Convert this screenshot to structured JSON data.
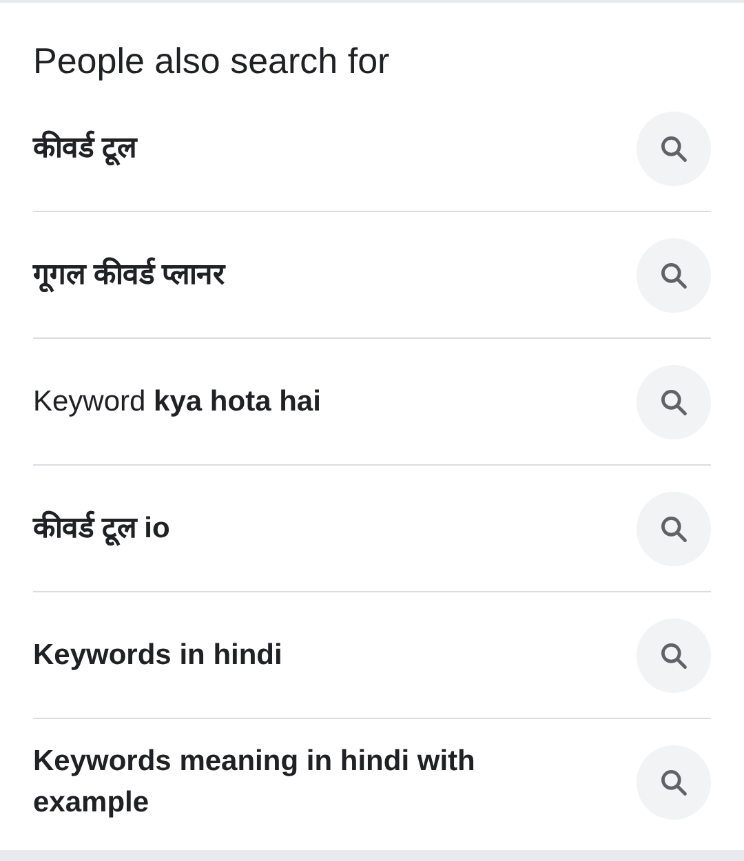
{
  "title": "People also search for",
  "items": [
    {
      "text": "**कीवर्ड टूल**"
    },
    {
      "text": "**गूगल कीवर्ड प्लानर**"
    },
    {
      "text": "Keyword **kya hota hai**"
    },
    {
      "text": "**कीवर्ड टूल io**"
    },
    {
      "text": "**Keywords in hindi**"
    },
    {
      "text": "**Keywords meaning in hindi with example**"
    }
  ]
}
